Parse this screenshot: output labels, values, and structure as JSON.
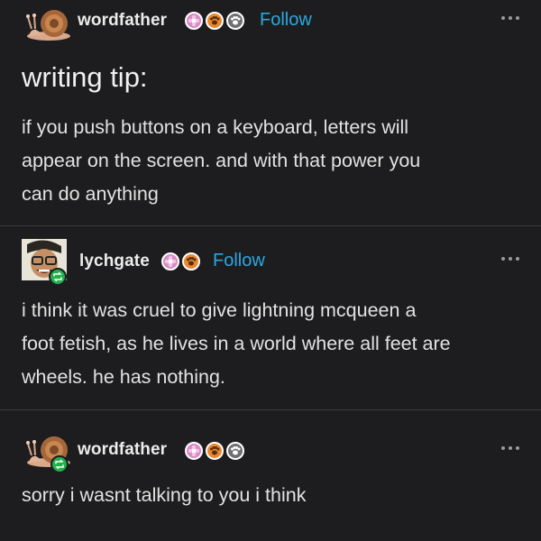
{
  "posts": [
    {
      "username": "wordfather",
      "follow_label": "Follow",
      "title": "writing tip:",
      "body_lines": [
        "if you push buttons on a keyboard, letters will",
        "appear on the screen. and with that power you",
        "can do anything"
      ],
      "avatar_icon": "snail-icon",
      "badges": [
        "pink-flower-badge-icon",
        "orange-paw-badge-icon",
        "paw-badge-icon"
      ]
    },
    {
      "username": "lychgate",
      "follow_label": "Follow",
      "body_lines": [
        "i think it was cruel to give lightning mcqueen a",
        "foot fetish, as he lives in a world where all feet are",
        "wheels. he has nothing."
      ],
      "avatar_icon": "cartoon-face-icon",
      "badges": [
        "pink-flower-badge-icon",
        "orange-paw-badge-icon"
      ]
    },
    {
      "username": "wordfather",
      "body_lines": [
        "sorry i wasnt talking to you i think"
      ],
      "avatar_icon": "snail-icon",
      "badges": [
        "pink-flower-badge-icon",
        "orange-paw-badge-icon",
        "paw-badge-icon"
      ]
    }
  ],
  "colors": {
    "background": "#1d1d1f",
    "follow_link": "#2ca7e0",
    "reblog_badge": "#22b04b",
    "divider": "#3a3a3c"
  }
}
